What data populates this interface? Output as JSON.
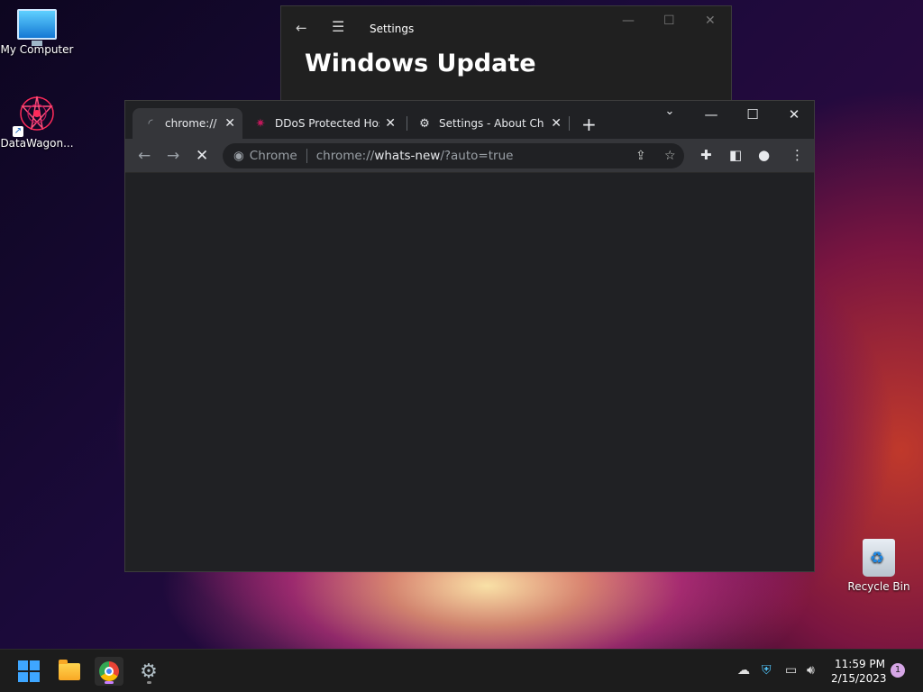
{
  "desktop": {
    "icons": [
      {
        "label": "My Computer"
      },
      {
        "label": "DataWagon..."
      },
      {
        "label": "Recycle Bin"
      }
    ]
  },
  "settings_window": {
    "title": "Settings",
    "heading": "Windows Update"
  },
  "chrome": {
    "tabs": [
      {
        "label": "chrome://whats-new/?auto=true",
        "favicon": "loading-spinner-icon"
      },
      {
        "label": "DDoS Protected Hosting",
        "favicon": "datawagon-icon"
      },
      {
        "label": "Settings - About Chrome",
        "favicon": "gear-icon"
      }
    ],
    "omnibox": {
      "chip": "Chrome",
      "scheme": "chrome://",
      "host": "whats-new",
      "path": "/?auto=true"
    }
  },
  "taskbar": {
    "clock": {
      "time": "11:59 PM",
      "date": "2/15/2023"
    },
    "notifications": "1",
    "accent": "#c77dff"
  },
  "colors": {
    "chrome_dark": "#202124",
    "chrome_toolbar": "#35363a",
    "taskbar": "#1c1c1c"
  }
}
